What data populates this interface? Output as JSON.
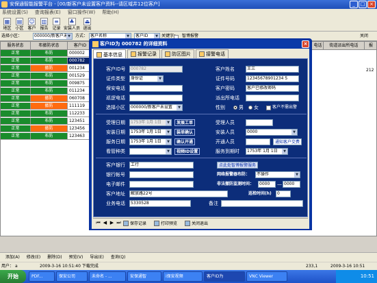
{
  "window": {
    "title": "安保通智能报警平台 - [00/新客户未设置客户资料--请区域井12位客户]"
  },
  "menu": [
    "系统设置(S)",
    "查询报表(E)",
    "窗口操作(W)",
    "帮助(H)"
  ],
  "toolbar": [
    {
      "label": "地区",
      "icon": "region-icon"
    },
    {
      "label": "小区",
      "icon": "district-icon"
    },
    {
      "label": "客户",
      "icon": "customer-icon"
    },
    {
      "label": "报告",
      "icon": "report-icon"
    },
    {
      "label": "记录",
      "icon": "record-icon"
    },
    {
      "label": "安装人员",
      "icon": "installer-icon"
    },
    {
      "label": "退出",
      "icon": "exit-icon"
    }
  ],
  "right_toolbar_label": "关闭",
  "filter": {
    "district_label": "选择小区：",
    "district_value": "000000/新客户未设",
    "method_label": "方式：",
    "method_value": "客户名称",
    "query_value": "客户ID",
    "keyword_label": "关键字：",
    "btn_query": "查询",
    "btn_print": "打印",
    "btn_preview": "预览",
    "btn_select": "选",
    "btn_map": "地图",
    "btn_close": "关闭",
    "alarm_check_label": "智博报警"
  },
  "grid": {
    "headers": [
      "服务状态",
      "布撤防状态",
      "客户ID"
    ],
    "right_headers": [
      "电话",
      "街道派出所电话",
      "报"
    ],
    "rows": [
      {
        "service": "正常",
        "arm": "布防",
        "id": "000002"
      },
      {
        "service": "正常",
        "arm": "布防",
        "id": "000782"
      },
      {
        "service": "正常",
        "arm": "撤防",
        "id": "001234"
      },
      {
        "service": "正常",
        "arm": "布防",
        "id": "001529"
      },
      {
        "service": "正常",
        "arm": "布防",
        "id": "009875"
      },
      {
        "service": "正常",
        "arm": "布防",
        "id": "011234"
      },
      {
        "service": "正常",
        "arm": "撤防",
        "id": "060708"
      },
      {
        "service": "正常",
        "arm": "撤防",
        "id": "111119"
      },
      {
        "service": "正常",
        "arm": "布防",
        "id": "112233"
      },
      {
        "service": "正常",
        "arm": "布防",
        "id": "123451"
      },
      {
        "service": "正常",
        "arm": "撤防",
        "id": "123456"
      },
      {
        "service": "正常",
        "arm": "布防",
        "id": "123463"
      }
    ],
    "right_value": "212"
  },
  "bottom_bar": [
    "添加(A)",
    "修改(E)",
    "删除(D)",
    "预览(V)",
    "导出(E)",
    "查询(Q)"
  ],
  "status": {
    "user": "用户：",
    "user_value": "a",
    "time": "2009-3-16 10:51:40 下载完成",
    "coord": "233,1",
    "right_time": "2009-3-16 10:51"
  },
  "taskbar": {
    "start": "开始",
    "tasks": [
      "PDF...",
      "保安公司",
      "未命名 - ...",
      "安保通智",
      "i保安视频",
      "客户ID为",
      "VNC Viewer"
    ],
    "active_index": 5,
    "clock": "10:51"
  },
  "dialog": {
    "title": "客户ID为 000782 的详细资料",
    "tabs": [
      "基本信息",
      "报警记录",
      "防区图片",
      "接警电话"
    ],
    "left": [
      {
        "label": "客户ID号",
        "value": "000782"
      },
      {
        "label": "证件类型",
        "value": "身份证"
      },
      {
        "label": "保安电话",
        "value": ""
      },
      {
        "label": "巡逻电话",
        "value": ""
      },
      {
        "label": "选择小区",
        "value": "000000/新客户未设置"
      }
    ],
    "right": [
      {
        "label": "客户姓名",
        "value": "王三"
      },
      {
        "label": "证件号码",
        "value": "12345678901234 5"
      },
      {
        "label": "客户密码",
        "value": "客户已修改密码"
      },
      {
        "label": "派出所电话",
        "value": ""
      }
    ],
    "gender_label": "性别",
    "male": "男",
    "female": "女",
    "no_alert_label": "客户不需出警",
    "dates": [
      {
        "label": "受理日期",
        "value": "1753年 1月 1日",
        "btn": "发展工单"
      },
      {
        "label": "安装日期",
        "value": "1753年 1月 1日",
        "btn": "装单确认"
      },
      {
        "label": "服务日期",
        "value": "1753年 1月 1日",
        "btn": "确认开通"
      },
      {
        "label": "看管种类",
        "value": "",
        "btn": "视频ID设置"
      }
    ],
    "people": [
      {
        "label": "受理人员",
        "value": ""
      },
      {
        "label": "安装人员",
        "value": "0000"
      },
      {
        "label": "开通人员",
        "value": "",
        "link": "通知客户交费"
      },
      {
        "label": "服务到期时",
        "value": "1753年 1月 1日"
      }
    ],
    "bank_label": "客户银行",
    "bank_value": "工行",
    "account_label": "银行帐号",
    "account_value": "",
    "email_label": "电子邮件",
    "email_value": "",
    "address_label": "客户地址",
    "address_value": "解放路22号",
    "biz_phone_label": "业务电话",
    "biz_phone_value": "5330528",
    "remark_label": "备注",
    "remark_value": "",
    "alarm_service_btn": "点此处智博报警服务",
    "net_alarm_label": "网络报警器布防：",
    "net_alarm_value": "不操作",
    "non_arm_label": "非法撤防监测时间：",
    "non_arm_from": "0000",
    "non_arm_to": "0000",
    "patrol_label": "巡检时间(h)",
    "patrol_value": "0",
    "nav": {
      "save": "保存记录",
      "print": "打印预览",
      "close": "关闭退出"
    }
  }
}
